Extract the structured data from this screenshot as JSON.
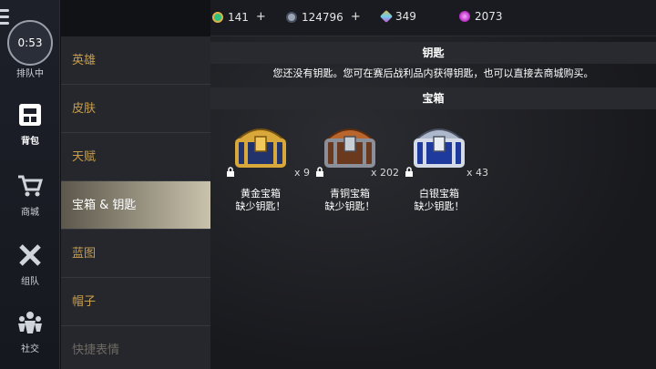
{
  "queue": {
    "timer": "0:53",
    "label": "排队中"
  },
  "rail": [
    {
      "label": "背包",
      "active": true
    },
    {
      "label": "商城",
      "active": false
    },
    {
      "label": "组队",
      "active": false
    },
    {
      "label": "社交",
      "active": false
    }
  ],
  "categories": [
    {
      "label": "英雄"
    },
    {
      "label": "皮肤"
    },
    {
      "label": "天赋"
    },
    {
      "label": "宝箱 & 钥匙"
    },
    {
      "label": "蓝图"
    },
    {
      "label": "帽子"
    },
    {
      "label": "快捷表情"
    }
  ],
  "currencies": [
    {
      "value": "141",
      "plus": "+",
      "color": "#2ec27e"
    },
    {
      "value": "124796",
      "plus": "+",
      "color": "#9aa6b8"
    },
    {
      "value": "349",
      "plus": "",
      "color": "#e0b24a"
    },
    {
      "value": "2073",
      "plus": "",
      "color": "#d24ad8"
    }
  ],
  "keys_section": {
    "title": "钥匙",
    "message": "您还没有钥匙。您可在赛后战利品内获得钥匙，也可以直接去商城购买。"
  },
  "chest_section": {
    "title": "宝箱",
    "chests": [
      {
        "name": "黄金宝箱",
        "count": "x 9",
        "status": "缺少钥匙！",
        "color": "#d9a83a"
      },
      {
        "name": "青铜宝箱",
        "count": "x 202",
        "status": "缺少钥匙！",
        "color": "#b8652e"
      },
      {
        "name": "白银宝箱",
        "count": "x 43",
        "status": "缺少钥匙！",
        "color": "#aeb8cc"
      }
    ]
  }
}
